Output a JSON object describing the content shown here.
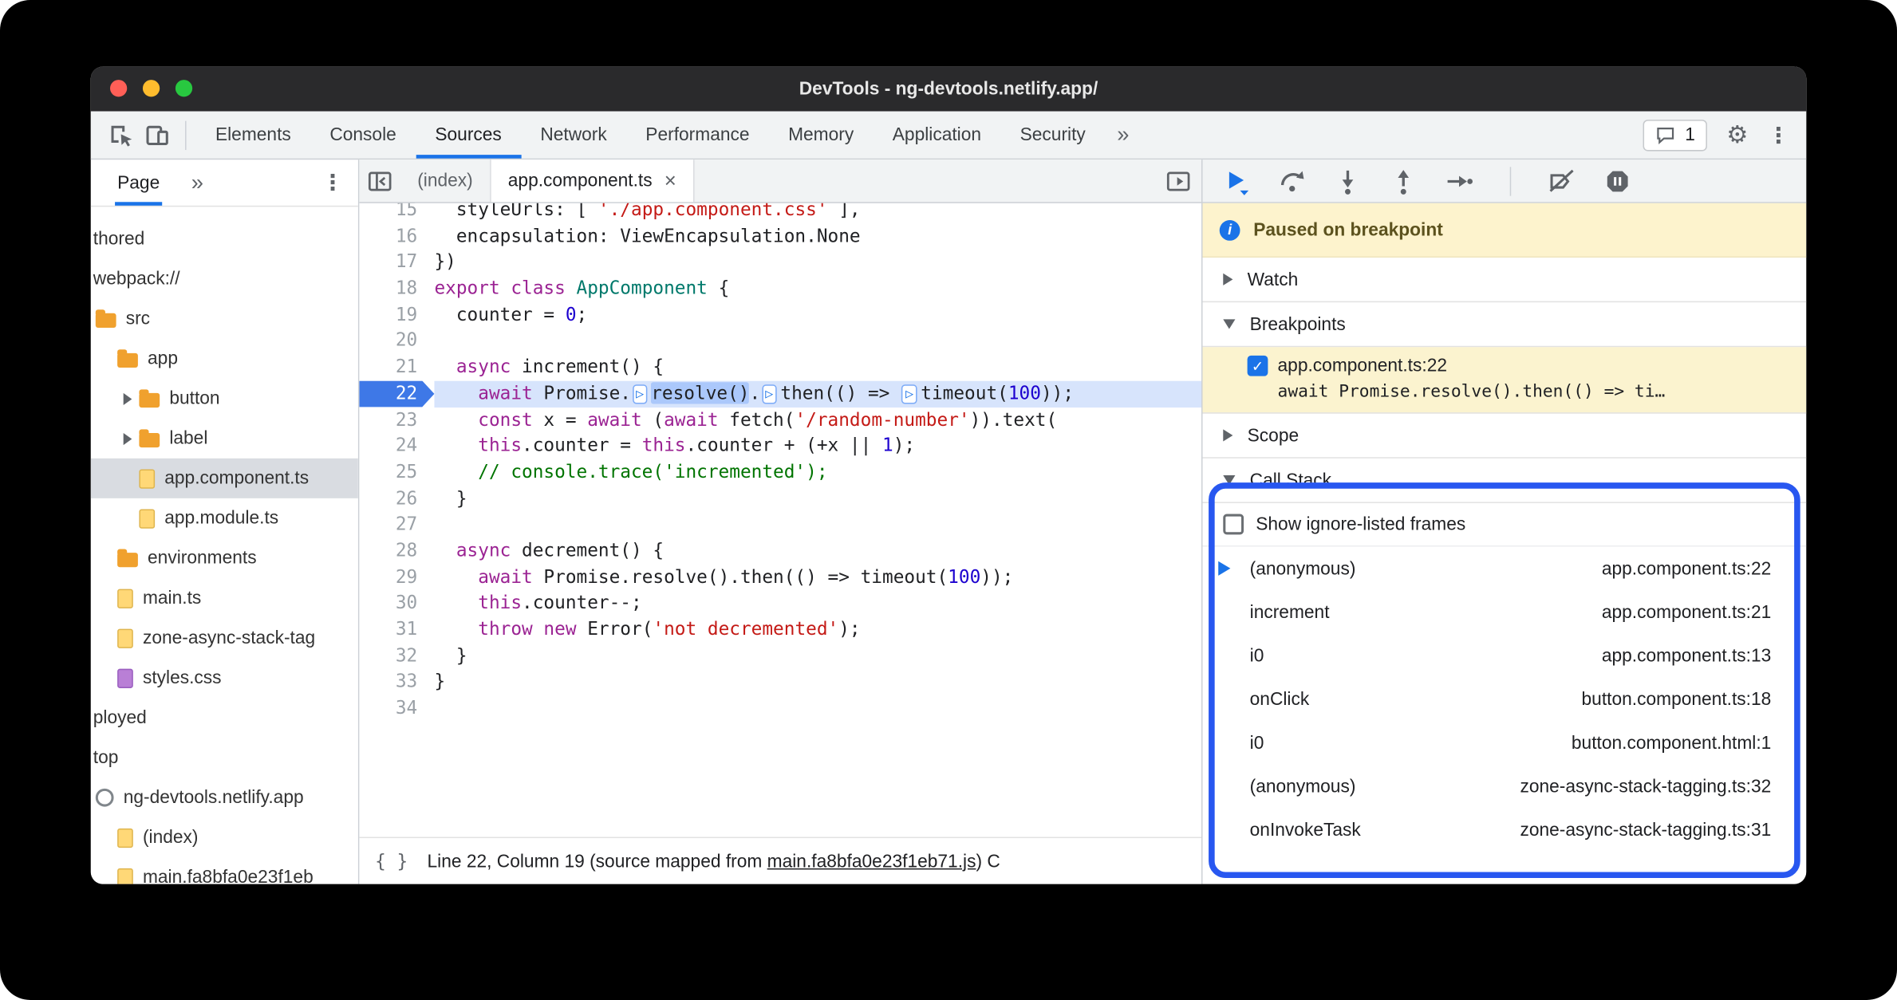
{
  "window": {
    "title": "DevTools - ng-devtools.netlify.app/",
    "traffic_lights": [
      "close",
      "minimize",
      "zoom"
    ]
  },
  "main_tabs": {
    "items": [
      "Elements",
      "Console",
      "Sources",
      "Network",
      "Performance",
      "Memory",
      "Application",
      "Security"
    ],
    "active": "Sources",
    "overflow": "»",
    "message_count": "1"
  },
  "navigator": {
    "tab": "Page",
    "more": "»",
    "menu": "⋮",
    "items": [
      {
        "label": "thored",
        "icon": "none",
        "indent": 0
      },
      {
        "label": "webpack://",
        "icon": "none",
        "indent": 0
      },
      {
        "label": "src",
        "icon": "folder",
        "indent": 1
      },
      {
        "label": "app",
        "icon": "folder",
        "indent": 2
      },
      {
        "label": "button",
        "icon": "folder",
        "indent": 3,
        "arrow": true
      },
      {
        "label": "label",
        "icon": "folder",
        "indent": 3,
        "arrow": true
      },
      {
        "label": "app.component.ts",
        "icon": "file",
        "indent": 3,
        "selected": true
      },
      {
        "label": "app.module.ts",
        "icon": "file",
        "indent": 3
      },
      {
        "label": "environments",
        "icon": "folder",
        "indent": 2
      },
      {
        "label": "main.ts",
        "icon": "file",
        "indent": 2
      },
      {
        "label": "zone-async-stack-tag",
        "icon": "file",
        "indent": 2
      },
      {
        "label": "styles.css",
        "icon": "file-purple",
        "indent": 2
      },
      {
        "label": "ployed",
        "icon": "none",
        "indent": 0
      },
      {
        "label": "top",
        "icon": "none",
        "indent": 0
      },
      {
        "label": "ng-devtools.netlify.app",
        "icon": "globe",
        "indent": 1
      },
      {
        "label": "(index)",
        "icon": "file",
        "indent": 2
      },
      {
        "label": "main.fa8bfa0e23f1eb",
        "icon": "file",
        "indent": 2
      }
    ]
  },
  "editor": {
    "tabs": [
      {
        "label": "(index)"
      },
      {
        "label": "app.component.ts",
        "close": "×",
        "active": true
      }
    ],
    "status": {
      "pretty_print": "{ }",
      "prefix": "Line 22, Column 19 (source mapped from ",
      "link": "main.fa8bfa0e23f1eb71.js",
      "suffix": ") C"
    }
  },
  "code": {
    "lines": [
      {
        "num": 15,
        "t": [
          [
            "pl",
            "  styleUrls: [ "
          ],
          [
            "str",
            "'./app.component.css'"
          ],
          [
            "pl",
            " ],"
          ]
        ]
      },
      {
        "num": 16,
        "t": [
          [
            "pl",
            "  encapsulation: ViewEncapsulation.None"
          ]
        ]
      },
      {
        "num": 17,
        "t": [
          [
            "pl",
            "})"
          ]
        ]
      },
      {
        "num": 18,
        "t": [
          [
            "kw",
            "export"
          ],
          [
            "pl",
            " "
          ],
          [
            "kw",
            "class"
          ],
          [
            "pl",
            " "
          ],
          [
            "def",
            "AppComponent"
          ],
          [
            "pl",
            " {"
          ]
        ]
      },
      {
        "num": 19,
        "t": [
          [
            "pl",
            "  counter = "
          ],
          [
            "num",
            "0"
          ],
          [
            "pl",
            ";"
          ]
        ]
      },
      {
        "num": 20,
        "t": []
      },
      {
        "num": 21,
        "t": [
          [
            "pl",
            "  "
          ],
          [
            "kw",
            "async"
          ],
          [
            "pl",
            " increment() {"
          ]
        ]
      },
      {
        "num": 22,
        "current": true,
        "t": [
          [
            "pl",
            "    "
          ],
          [
            "kw",
            "await"
          ],
          [
            "pl",
            " Promise."
          ],
          [
            "badge",
            "▷"
          ],
          [
            "sel",
            "resolve()"
          ],
          [
            "pl",
            "."
          ],
          [
            "badge",
            "▷"
          ],
          [
            "pl",
            "then(() => "
          ],
          [
            "badge",
            "▷"
          ],
          [
            "pl",
            "timeout("
          ],
          [
            "num",
            "100"
          ],
          [
            "pl",
            "));"
          ]
        ]
      },
      {
        "num": 23,
        "t": [
          [
            "pl",
            "    "
          ],
          [
            "kw",
            "const"
          ],
          [
            "pl",
            " x = "
          ],
          [
            "kw",
            "await"
          ],
          [
            "pl",
            " ("
          ],
          [
            "kw",
            "await"
          ],
          [
            "pl",
            " fetch("
          ],
          [
            "str",
            "'/random-number'"
          ],
          [
            "pl",
            ")).text("
          ]
        ]
      },
      {
        "num": 24,
        "t": [
          [
            "pl",
            "    "
          ],
          [
            "kw",
            "this"
          ],
          [
            "pl",
            ".counter = "
          ],
          [
            "kw",
            "this"
          ],
          [
            "pl",
            ".counter + (+x || "
          ],
          [
            "num",
            "1"
          ],
          [
            "pl",
            ");"
          ]
        ]
      },
      {
        "num": 25,
        "t": [
          [
            "cm",
            "    // console.trace('incremented');"
          ]
        ]
      },
      {
        "num": 26,
        "t": [
          [
            "pl",
            "  }"
          ]
        ]
      },
      {
        "num": 27,
        "t": []
      },
      {
        "num": 28,
        "t": [
          [
            "pl",
            "  "
          ],
          [
            "kw",
            "async"
          ],
          [
            "pl",
            " decrement() {"
          ]
        ]
      },
      {
        "num": 29,
        "t": [
          [
            "pl",
            "    "
          ],
          [
            "kw",
            "await"
          ],
          [
            "pl",
            " Promise.resolve().then(() => timeout("
          ],
          [
            "num",
            "100"
          ],
          [
            "pl",
            "));"
          ]
        ]
      },
      {
        "num": 30,
        "t": [
          [
            "pl",
            "    "
          ],
          [
            "kw",
            "this"
          ],
          [
            "pl",
            ".counter--;"
          ]
        ]
      },
      {
        "num": 31,
        "t": [
          [
            "pl",
            "    "
          ],
          [
            "kw",
            "throw"
          ],
          [
            "pl",
            " "
          ],
          [
            "kw",
            "new"
          ],
          [
            "pl",
            " Error("
          ],
          [
            "str",
            "'not decremented'"
          ],
          [
            "pl",
            ");"
          ]
        ]
      },
      {
        "num": 32,
        "t": [
          [
            "pl",
            "  }"
          ]
        ]
      },
      {
        "num": 33,
        "t": [
          [
            "pl",
            "}"
          ]
        ]
      },
      {
        "num": 34,
        "t": []
      }
    ]
  },
  "debugger": {
    "banner": "Paused on breakpoint",
    "sections": {
      "watch": "Watch",
      "breakpoints": "Breakpoints",
      "scope": "Scope",
      "call_stack": "Call Stack"
    },
    "ignore_label": "Show ignore-listed frames",
    "breakpoint": {
      "checked": true,
      "label": "app.component.ts:22",
      "snippet": "await Promise.resolve().then(() => ti…"
    },
    "call_stack_frames": [
      {
        "name": "(anonymous)",
        "loc": "app.component.ts:22",
        "current": true
      },
      {
        "name": "increment",
        "loc": "app.component.ts:21"
      },
      {
        "name": "i0",
        "loc": "app.component.ts:13"
      },
      {
        "name": "onClick",
        "loc": "button.component.ts:18"
      },
      {
        "name": "i0",
        "loc": "button.component.html:1"
      },
      {
        "name": "(anonymous)",
        "loc": "zone-async-stack-tagging.ts:32"
      },
      {
        "name": "onInvokeTask",
        "loc": "zone-async-stack-tagging.ts:31"
      }
    ]
  },
  "icons": {
    "gear": "⚙",
    "menu_dots": "⋮",
    "info": "i",
    "check": "✓"
  },
  "colors": {
    "accent": "#1a73e8",
    "annotation_blue": "#2857f0",
    "paused_banner_bg": "#fdf3cd",
    "breakpoint_bg": "#fbf3cf",
    "exec_line_bg": "#d7e4fc",
    "keyword": "#9b2393",
    "number": "#1c00cf",
    "string": "#c41a16",
    "comment": "#007400"
  }
}
